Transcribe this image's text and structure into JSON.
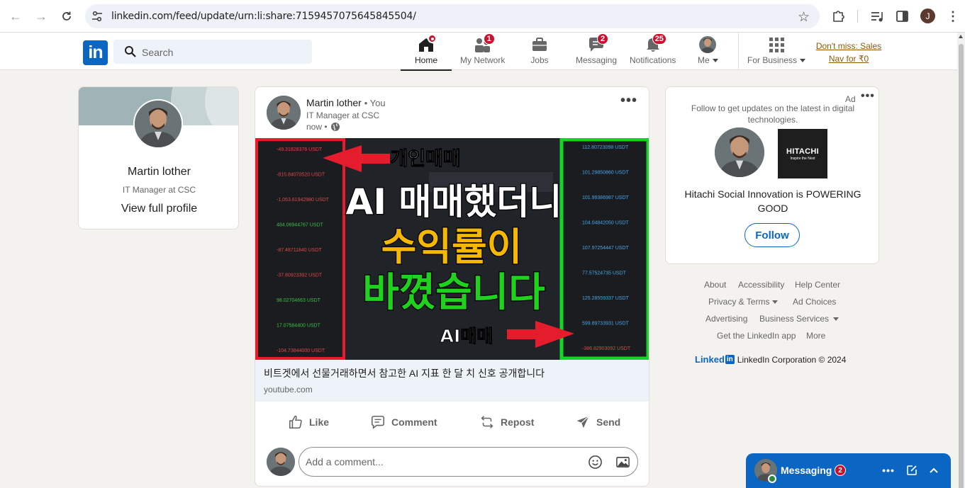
{
  "browser": {
    "url": "linkedin.com/feed/update/urn:li:share:7159457075645845504/",
    "profile_initial": "J"
  },
  "header": {
    "logo": "in",
    "search_placeholder": "Search",
    "nav": [
      {
        "label": "Home",
        "badge": "",
        "active": true
      },
      {
        "label": "My Network",
        "badge": "1"
      },
      {
        "label": "Jobs",
        "badge": ""
      },
      {
        "label": "Messaging",
        "badge": "2"
      },
      {
        "label": "Notifications",
        "badge": "25"
      },
      {
        "label": "Me",
        "badge": ""
      },
      {
        "label": "For Business",
        "badge": ""
      }
    ],
    "promo_line1": "Don't miss: Sales",
    "promo_line2": "Nav for ₹0"
  },
  "profile": {
    "name": "Martin lother",
    "title": "IT Manager at CSC",
    "link": "View full profile"
  },
  "post": {
    "author": "Martin lother",
    "you": "• You",
    "subtitle": "IT Manager at CSC",
    "time": "now •",
    "thumb": {
      "top_tag": "개인매매",
      "headline1": "AI 매매했더니",
      "headline2": "수익률이",
      "headline3": "바꼈습니다",
      "bottom_tag": "AI매매",
      "left_values": [
        "-49.31828376 USDT",
        "-815.84070520 USDT",
        "-1,053.61942980 USDT",
        "484.06944767 USDT",
        "-87.48711840 USDT",
        "-37.80923392 USDT",
        "98.02704663 USDT",
        "17.07584400 USDT",
        "-104.73844000 USDT"
      ],
      "right_values": [
        "112.80723098 USDT",
        "101.29850860 USDT",
        "101.99386987 USDT",
        "104.04842050 USDT",
        "107.97254447 USDT",
        "77.57524735 USDT",
        "125.28559337 USDT",
        "599.89733931 USDT",
        "-386.82903092 USDT"
      ]
    },
    "link_title": "비트겟에서 선물거래하면서 참고한 AI 지표 한 달 치 신호 공개합니다",
    "link_domain": "youtube.com",
    "actions": {
      "like": "Like",
      "comment": "Comment",
      "repost": "Repost",
      "send": "Send"
    },
    "comment_placeholder": "Add a comment..."
  },
  "ad": {
    "label": "Ad",
    "description": "Follow to get updates on the latest in digital technologies.",
    "logo_text": "HITACHI",
    "logo_tagline": "Inspire the Next",
    "headline": "Hitachi Social Innovation is POWERING GOOD",
    "follow": "Follow"
  },
  "footer": {
    "about": "About",
    "accessibility": "Accessibility",
    "help": "Help Center",
    "privacy": "Privacy & Terms",
    "adchoices": "Ad Choices",
    "advertising": "Advertising",
    "business": "Business Services",
    "app": "Get the LinkedIn app",
    "more": "More",
    "brand_word": "Linked",
    "brand_in": "in",
    "copyright": "LinkedIn Corporation © 2024"
  },
  "messaging": {
    "title": "Messaging",
    "badge": "2"
  },
  "colors": {
    "linkedin_blue": "#0a66c2",
    "badge_red": "#cb112d",
    "background": "#f4f2ee"
  }
}
